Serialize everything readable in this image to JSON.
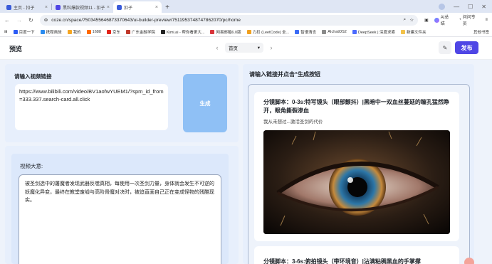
{
  "browser": {
    "tabs": [
      {
        "title": "主页 - 扣子",
        "color": "#3a5bd9"
      },
      {
        "title": "黑料爆款视频11 - 扣子",
        "color": "#4f46e5"
      },
      {
        "title": "扣子",
        "color": "#3a5bd9"
      }
    ],
    "active_tab": 2,
    "url": "coze.cn/space/7503455646873370643/ui-builder-preview/7511953748747862070/pc/home",
    "ai_label": "AI总结",
    "notify_label": "问问专员",
    "bookmarks": [
      {
        "label": "百度一下",
        "color": "#2d5cf6"
      },
      {
        "label": "携程商旅",
        "color": "#2b8cf0"
      },
      {
        "label": "我的",
        "color": "#f5a623"
      },
      {
        "label": "1688",
        "color": "#ff6a00"
      },
      {
        "label": "京东",
        "color": "#e1251b"
      },
      {
        "label": "广东金融学院",
        "color": "#c0392b"
      },
      {
        "label": "Kimi.ai - 帮你看更大...",
        "color": "#222222"
      },
      {
        "label": "网易邮箱6.0版",
        "color": "#d9343a"
      },
      {
        "label": "力扣 (LeetCode) 全...",
        "color": "#f0a020"
      },
      {
        "label": "智谱清言",
        "color": "#3b6cf6"
      },
      {
        "label": "AIchatOS2",
        "color": "#8a8a8a"
      },
      {
        "label": "DeepSeek | 深度求索",
        "color": "#4d6bfe"
      },
      {
        "label": "新建文件夹",
        "color": "#f3c24a"
      }
    ],
    "bookmarks_overflow": "其他书签"
  },
  "header": {
    "title": "预览",
    "page_select": "首页",
    "publish_label": "发布"
  },
  "left": {
    "url_label": "请输入视频链接",
    "url_value": "https://www.bilibili.com/video/BV1aofwYUEM1/?spm_id_from=333.337.search-card.all.click",
    "generate_label": "生成",
    "summary_label": "视频大意:",
    "summary_text": "被圣剑选中的屠魔者发现武器反噬真相，每使用一次圣剑力量，身体就会发生不可逆的妖魔化异变，最终在教堂废墟与高阶骨魔对决时，被迫直面自己正在变成怪物的残酷现实。"
  },
  "right": {
    "heading": "请输入链接并点击“生成按钮",
    "shots": [
      {
        "title": "分镜脚本：0-3s:特写镜头（眼部颤抖）|黑暗中一双血丝蔓延的瞳孔猛然睁开，眼角撕裂渗血",
        "subtitle": "我从未想过...激活圣剑的代价"
      },
      {
        "title": "分镜脚本：3-6s:俯拍镜头（带环境音）|沾满粘稠黑血的手掌撑"
      }
    ]
  },
  "colors": {
    "accent": "#4f46e5",
    "generate_button": "#8fc0f5",
    "panel_bg": "#e7effc"
  }
}
